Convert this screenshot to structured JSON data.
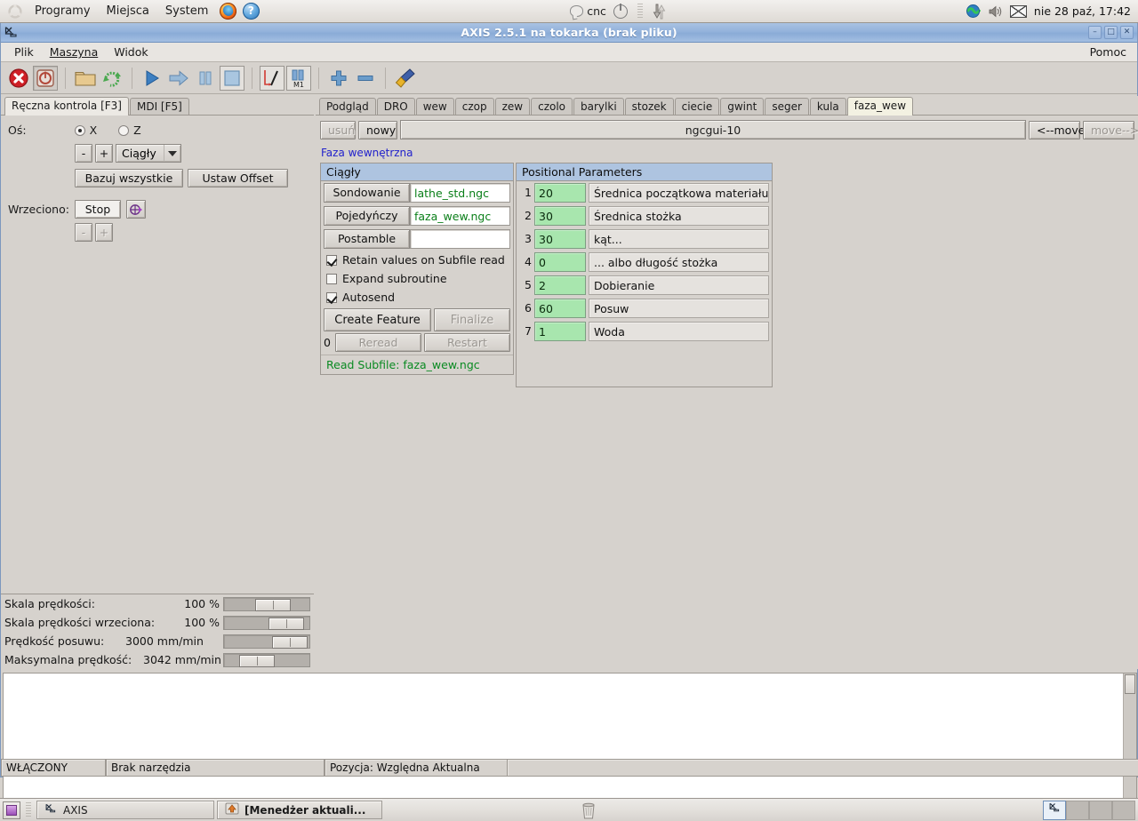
{
  "desktop": {
    "panel": {
      "menus": [
        "Programy",
        "Miejsca",
        "System"
      ],
      "launchers": [
        {
          "name": "firefox-icon",
          "label": "Firefox"
        },
        {
          "name": "help-icon",
          "label": "?"
        }
      ],
      "tray": {
        "user_label": "cnc",
        "clock": "nie 28 paź, 17:42"
      }
    },
    "taskbar": {
      "show_desktop": "Pokaż pulpit",
      "tasks": [
        {
          "label": "AXIS",
          "active": false
        },
        {
          "label": "[Menedżer aktuali...",
          "active": true
        }
      ]
    }
  },
  "window": {
    "title": "AXIS 2.5.1 na tokarka (brak pliku)",
    "buttons": {
      "minimize": "–",
      "maximize": "□",
      "close": "✕"
    },
    "menubar": {
      "items": [
        "Plik",
        "Maszyna",
        "Widok"
      ],
      "help": "Pomoc"
    },
    "toolbar": {
      "items": [
        {
          "name": "estop-icon",
          "title": "Przełącz wyłącznik awaryjny"
        },
        {
          "name": "power-icon",
          "title": "Przełącz zasilanie maszyny"
        },
        {
          "name": "open-file-icon",
          "title": "Otwórz plik G-code"
        },
        {
          "name": "reload-file-icon",
          "title": "Przeładuj plik"
        },
        {
          "name": "run-icon",
          "title": "Uruchom program"
        },
        {
          "name": "step-icon",
          "title": "Krok"
        },
        {
          "name": "pause-icon",
          "title": "Pauza"
        },
        {
          "name": "stop-icon",
          "title": "Stop"
        },
        {
          "name": "block-delete-icon",
          "title": "Pomiń kasowanie bloku"
        },
        {
          "name": "optional-stop-icon",
          "title": "Opcjonalne zatrzymanie M1"
        },
        {
          "name": "zoom-in-icon",
          "title": "Powiększ"
        },
        {
          "name": "zoom-out-icon",
          "title": "Pomniejsz"
        },
        {
          "name": "clear-backplot-icon",
          "title": "Wyczyść wykres"
        }
      ]
    }
  },
  "left_panel": {
    "tabs": [
      {
        "label": "Ręczna kontrola [F3]",
        "active": true
      },
      {
        "label": "MDI [F5]",
        "active": false
      }
    ],
    "axis": {
      "label": "Oś:",
      "options": [
        {
          "label": "X",
          "selected": true
        },
        {
          "label": "Z",
          "selected": false
        }
      ]
    },
    "jog": {
      "minus": "-",
      "plus": "+",
      "mode": "Ciągły"
    },
    "home_all": "Bazuj wszystkie",
    "set_offset": "Ustaw Offset",
    "spindle": {
      "label": "Wrzeciono:",
      "stop": "Stop",
      "cw_icon": "spindle-cw-icon",
      "minus": "-",
      "plus": "+"
    },
    "sliders": [
      {
        "label": "Skala prędkości:",
        "value": "100 %",
        "pos": 36
      },
      {
        "label": "Skala prędkości wrzeciona:",
        "value": "100 %",
        "pos": 74
      },
      {
        "label": "Prędkość posuwu:",
        "value": "3000 mm/min",
        "pos": 78
      },
      {
        "label": "Maksymalna prędkość:",
        "value": "3042 mm/min",
        "pos": 18
      }
    ]
  },
  "right_panel": {
    "tabs": [
      {
        "label": "Podgląd",
        "active": false
      },
      {
        "label": "DRO",
        "active": false
      },
      {
        "label": "wew",
        "active": false
      },
      {
        "label": "czop",
        "active": false
      },
      {
        "label": "zew",
        "active": false
      },
      {
        "label": "czolo",
        "active": false
      },
      {
        "label": "barylki",
        "active": false
      },
      {
        "label": "stozek",
        "active": false
      },
      {
        "label": "ciecie",
        "active": false
      },
      {
        "label": "gwint",
        "active": false
      },
      {
        "label": "seger",
        "active": false
      },
      {
        "label": "kula",
        "active": false
      },
      {
        "label": "faza_wew",
        "active": true
      }
    ],
    "ngcgui": {
      "delete_button": "usuń",
      "new_button": "nowy",
      "tab_name": "ngcgui-10",
      "move_left": "<--move",
      "move_right": "move-->",
      "subtitle": "Faza wewnętrzna",
      "left_box": {
        "header": "Ciągły",
        "fields": [
          {
            "button": "Sondowanie",
            "value": "lathe_std.ngc"
          },
          {
            "button": "Pojedyńczy",
            "value": "faza_wew.ngc"
          },
          {
            "button": "Postamble",
            "value": ""
          }
        ],
        "checkboxes": [
          {
            "label": "Retain values on Subfile read",
            "checked": true
          },
          {
            "label": "Expand subroutine",
            "checked": false
          },
          {
            "label": "Autosend",
            "checked": true
          }
        ],
        "create_feature": "Create Feature",
        "finalize": "Finalize",
        "count": "0",
        "reread": "Reread",
        "restart": "Restart",
        "status": "Read Subfile: faza_wew.ngc"
      },
      "params_box": {
        "header": "Positional Parameters",
        "rows": [
          {
            "index": "1",
            "value": "20",
            "description": "Średnica początkowa materiału"
          },
          {
            "index": "2",
            "value": "30",
            "description": "Średnica stożka"
          },
          {
            "index": "3",
            "value": "30",
            "description": "kąt..."
          },
          {
            "index": "4",
            "value": "0",
            "description": "... albo długość stożka"
          },
          {
            "index": "5",
            "value": "2",
            "description": "Dobieranie"
          },
          {
            "index": "6",
            "value": "60",
            "description": "Posuw"
          },
          {
            "index": "7",
            "value": "1",
            "description": "Woda"
          }
        ]
      }
    }
  },
  "gcode_view": {
    "content": ""
  },
  "status_bar": {
    "cells": [
      "WŁĄCZONY",
      "Brak narzędzia",
      "Pozycja: Względna Aktualna"
    ]
  },
  "colors": {
    "accent_blue": "#8aabd7",
    "header_blue": "#aec4e0",
    "param_green": "#a8e6ae",
    "link_blue": "#2222cc",
    "status_green": "#0a8a22",
    "field_text_green": "#0a7f19"
  }
}
